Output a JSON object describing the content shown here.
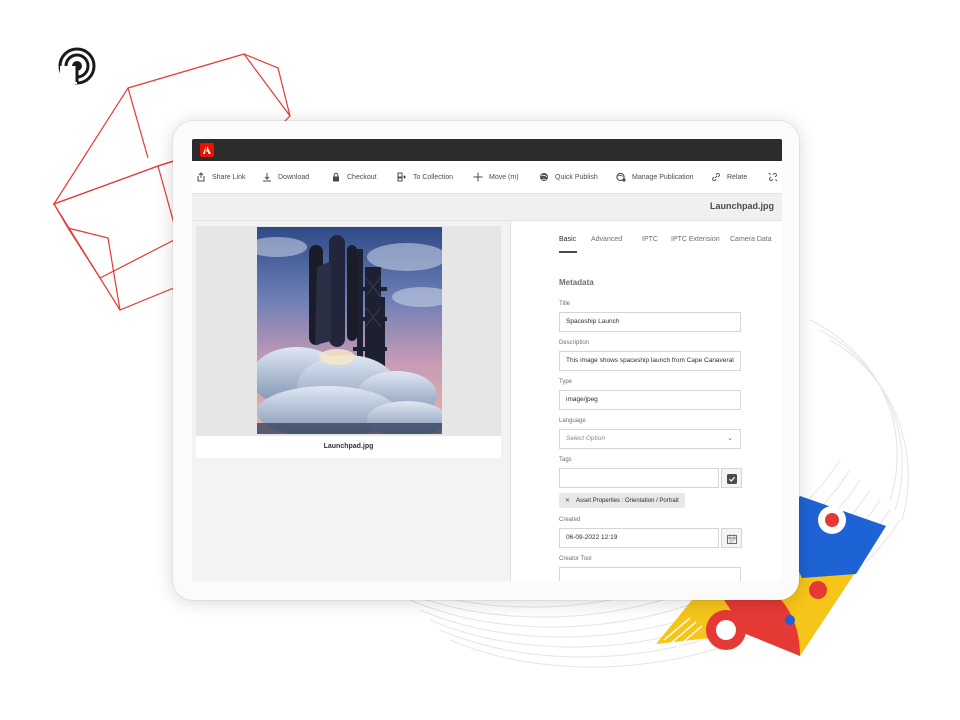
{
  "colors": {
    "adobe_red": "#eb1000",
    "topbar": "#2c2c2c",
    "deco_red": "#e53935",
    "deco_yellow": "#f6c51a",
    "deco_blue": "#1e63d6"
  },
  "toolbar": {
    "actions": [
      {
        "icon": "share-link-icon",
        "label": "Share Link"
      },
      {
        "icon": "download-icon",
        "label": "Download"
      },
      {
        "icon": "lock-icon",
        "label": "Checkout"
      },
      {
        "icon": "collection-icon",
        "label": "To Collection"
      },
      {
        "icon": "move-icon",
        "label": "Move (m)"
      },
      {
        "icon": "globe-icon",
        "label": "Quick Publish"
      },
      {
        "icon": "manage-publication-icon",
        "label": "Manage Publication"
      },
      {
        "icon": "relate-icon",
        "label": "Relate"
      },
      {
        "icon": "unrelate-icon",
        "label": ""
      }
    ]
  },
  "asset": {
    "title": "Launchpad.jpg",
    "caption": "Launchpad.jpg"
  },
  "tabs": [
    {
      "label": "Basic",
      "active": true
    },
    {
      "label": "Advanced",
      "active": false
    },
    {
      "label": "IPTC",
      "active": false
    },
    {
      "label": "IPTC Extension",
      "active": false
    },
    {
      "label": "Camera Data",
      "active": false
    }
  ],
  "metadata": {
    "section_title": "Metadata",
    "title_label": "Title",
    "title_value": "Spaceship Launch",
    "description_label": "Description",
    "description_value": "This image shows spaceship launch from Cape Canaveral",
    "type_label": "Type",
    "type_value": "image/jpeg",
    "language_label": "Language",
    "language_placeholder": "Select Option",
    "tags_label": "Tags",
    "tags_value": "",
    "tag_chip": "Asset Properties : Orientation / Portrait",
    "created_label": "Created",
    "created_value": "06-09-2022 12:19",
    "creator_tool_label": "Creator Tool",
    "creator_tool_value": ""
  }
}
